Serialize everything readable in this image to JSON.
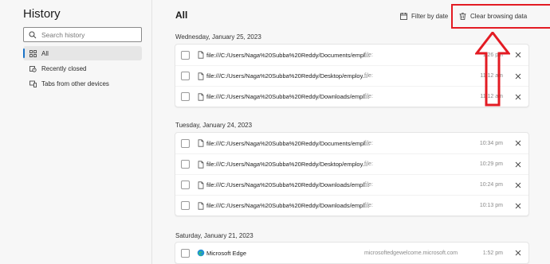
{
  "sidebar": {
    "title": "History",
    "search_placeholder": "Search history",
    "items": [
      {
        "label": "All",
        "icon": "grid-icon",
        "active": true
      },
      {
        "label": "Recently closed",
        "icon": "recent-tab-icon",
        "active": false
      },
      {
        "label": "Tabs from other devices",
        "icon": "devices-icon",
        "active": false
      }
    ]
  },
  "main": {
    "title": "All",
    "filter_label": "Filter by date",
    "clear_label": "Clear browsing data",
    "highlight_color": "#e31b23"
  },
  "groups": [
    {
      "date": "Wednesday, January 25, 2023",
      "rows": [
        {
          "title": "file:///C:/Users/Naga%20Subba%20Reddy/Documents/empl...",
          "domain": "file:",
          "time": "1:26 pm",
          "favicon": "file-icon"
        },
        {
          "title": "file:///C:/Users/Naga%20Subba%20Reddy/Desktop/employ...",
          "domain": "file:",
          "time": "11:12 am",
          "favicon": "file-icon"
        },
        {
          "title": "file:///C:/Users/Naga%20Subba%20Reddy/Downloads/empl...",
          "domain": "file:",
          "time": "11:12 am",
          "favicon": "file-icon"
        }
      ]
    },
    {
      "date": "Tuesday, January 24, 2023",
      "rows": [
        {
          "title": "file:///C:/Users/Naga%20Subba%20Reddy/Documents/empl...",
          "domain": "file:",
          "time": "10:34 pm",
          "favicon": "file-icon"
        },
        {
          "title": "file:///C:/Users/Naga%20Subba%20Reddy/Desktop/employ...",
          "domain": "file:",
          "time": "10:29 pm",
          "favicon": "file-icon"
        },
        {
          "title": "file:///C:/Users/Naga%20Subba%20Reddy/Downloads/empl...",
          "domain": "file:",
          "time": "10:24 pm",
          "favicon": "file-icon"
        },
        {
          "title": "file:///C:/Users/Naga%20Subba%20Reddy/Downloads/empl...",
          "domain": "file:",
          "time": "10:13 pm",
          "favicon": "file-icon"
        }
      ]
    },
    {
      "date": "Saturday, January 21, 2023",
      "rows": [
        {
          "title": "Microsoft Edge",
          "domain": "microsoftedgewelcome.microsoft.com",
          "time": "1:52 pm",
          "favicon": "edge-icon"
        }
      ]
    }
  ]
}
